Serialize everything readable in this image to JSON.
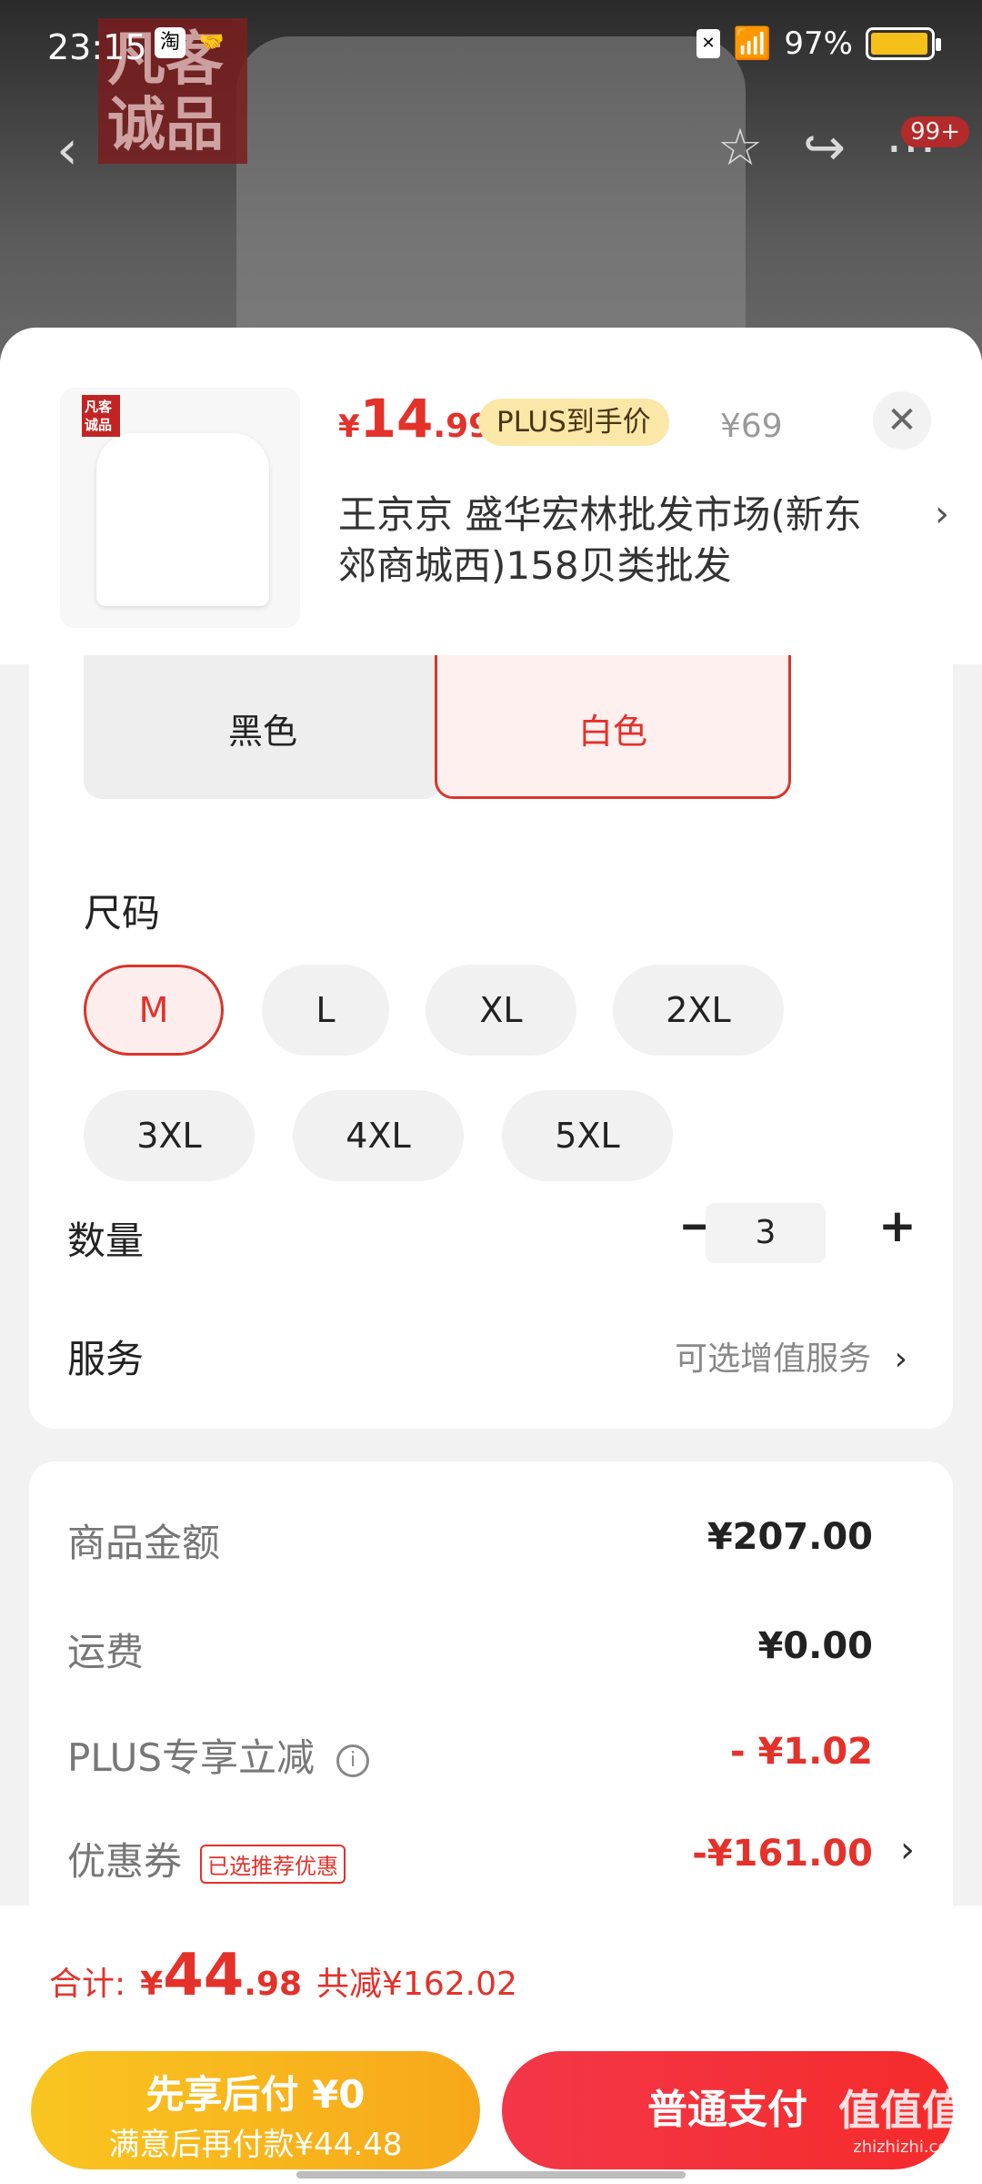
{
  "status_bar": {
    "time": "23:15",
    "app_icon_1": "淘",
    "battery_percent": "97%",
    "battery_level": 0.97
  },
  "background": {
    "logo_line1": "凡客",
    "logo_line2": "诚品",
    "badge": "99+"
  },
  "product": {
    "thumb_logo": "凡客诚品",
    "price_symbol": "¥",
    "price_int": "14",
    "price_dec": ".99",
    "plus_badge": "PLUS到手价",
    "original_price": "¥69",
    "shop_name": "王京京  盛华宏林批发市场(新东郊商城西)158贝类批发"
  },
  "colors": {
    "options": [
      "黑色",
      "白色"
    ],
    "selected": "白色"
  },
  "size": {
    "title": "尺码",
    "options": [
      "M",
      "L",
      "XL",
      "2XL",
      "3XL",
      "4XL",
      "5XL"
    ],
    "selected": "M"
  },
  "quantity": {
    "label": "数量",
    "minus": "−",
    "value": "3",
    "plus": "+"
  },
  "service": {
    "label": "服务",
    "value": "可选增值服务"
  },
  "summary": {
    "goods_label": "商品金额",
    "goods_value": "¥207.00",
    "shipping_label": "运费",
    "shipping_value": "¥0.00",
    "plus_label": "PLUS专享立减",
    "plus_value": "- ¥1.02",
    "coupon_label": "优惠券",
    "coupon_tag": "已选推荐优惠",
    "coupon_value": "-¥161.00"
  },
  "bottom": {
    "total_label": "合计:",
    "total_symbol": "¥",
    "total_int": "44",
    "total_dec": ".98",
    "total_saving": "共减¥162.02",
    "paylater_line1": "先享后付 ¥0",
    "paylater_line2": "满意后再付款¥44.48",
    "normal_pay": "普通支付"
  },
  "watermark": {
    "text": "值值值",
    "sub": "zhizhizhi.com"
  },
  "colors_hex": {
    "accent_red": "#e4312a",
    "pay_later_yellow": "#f9c520",
    "plus_gold": "#fbe7a8"
  }
}
